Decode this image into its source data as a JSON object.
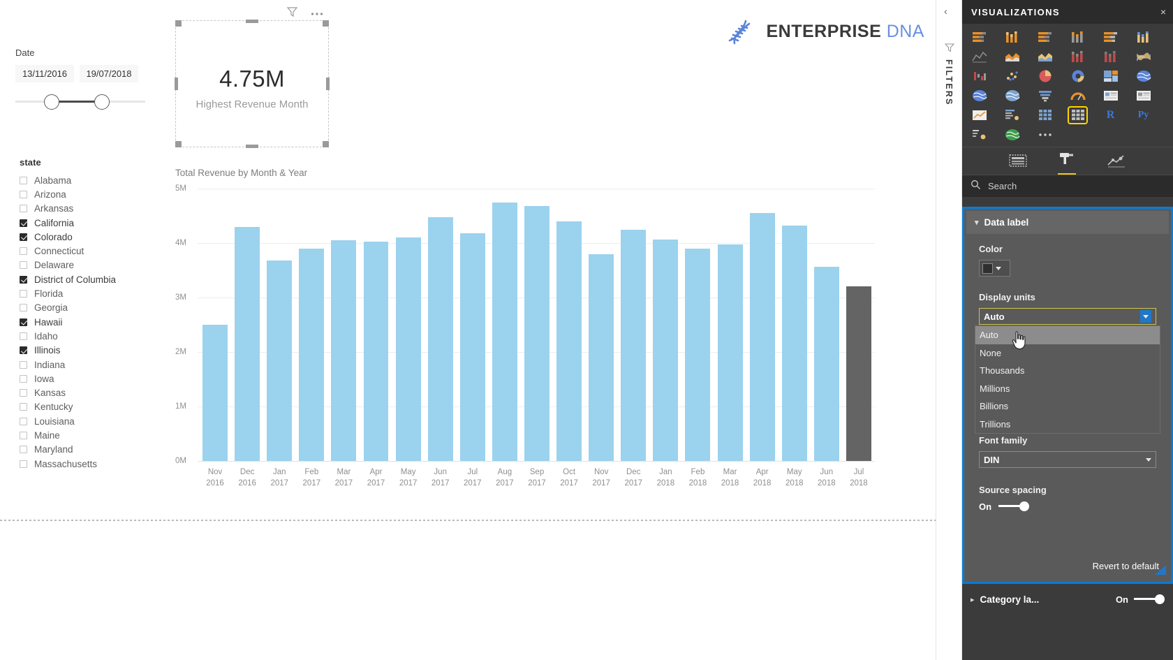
{
  "report": {
    "date_slicer": {
      "title": "Date",
      "start": "13/11/2016",
      "end": "19/07/2018"
    },
    "state_slicer": {
      "title": "state",
      "items": [
        {
          "label": "Alabama",
          "checked": false
        },
        {
          "label": "Arizona",
          "checked": false
        },
        {
          "label": "Arkansas",
          "checked": false
        },
        {
          "label": "California",
          "checked": true
        },
        {
          "label": "Colorado",
          "checked": true
        },
        {
          "label": "Connecticut",
          "checked": false
        },
        {
          "label": "Delaware",
          "checked": false
        },
        {
          "label": "District of Columbia",
          "checked": true
        },
        {
          "label": "Florida",
          "checked": false
        },
        {
          "label": "Georgia",
          "checked": false
        },
        {
          "label": "Hawaii",
          "checked": true
        },
        {
          "label": "Idaho",
          "checked": false
        },
        {
          "label": "Illinois",
          "checked": true
        },
        {
          "label": "Indiana",
          "checked": false
        },
        {
          "label": "Iowa",
          "checked": false
        },
        {
          "label": "Kansas",
          "checked": false
        },
        {
          "label": "Kentucky",
          "checked": false
        },
        {
          "label": "Louisiana",
          "checked": false
        },
        {
          "label": "Maine",
          "checked": false
        },
        {
          "label": "Maryland",
          "checked": false
        },
        {
          "label": "Massachusetts",
          "checked": false
        }
      ]
    },
    "card": {
      "value": "4.75M",
      "label": "Highest Revenue Month"
    },
    "logo": {
      "word1": "ENTERPRISE",
      "word2": "DNA"
    }
  },
  "chart_data": {
    "type": "bar",
    "title": "Total Revenue by Month & Year",
    "xlabel": "",
    "ylabel": "",
    "ylim": [
      0,
      5000000
    ],
    "grid": true,
    "legend": null,
    "tick_labels_y": [
      "0M",
      "1M",
      "2M",
      "3M",
      "4M",
      "5M"
    ],
    "bar_color": "#9bd2ee",
    "highlight_color": "#646464",
    "highlight_index": 20,
    "categories": [
      "Nov 2016",
      "Dec 2016",
      "Jan 2017",
      "Feb 2017",
      "Mar 2017",
      "Apr 2017",
      "May 2017",
      "Jun 2017",
      "Jul 2017",
      "Aug 2017",
      "Sep 2017",
      "Oct 2017",
      "Nov 2017",
      "Dec 2017",
      "Jan 2018",
      "Feb 2018",
      "Mar 2018",
      "Apr 2018",
      "May 2018",
      "Jun 2018",
      "Jul 2018"
    ],
    "categories_month": [
      "Nov",
      "Dec",
      "Jan",
      "Feb",
      "Mar",
      "Apr",
      "May",
      "Jun",
      "Jul",
      "Aug",
      "Sep",
      "Oct",
      "Nov",
      "Dec",
      "Jan",
      "Feb",
      "Mar",
      "Apr",
      "May",
      "Jun",
      "Jul"
    ],
    "categories_year": [
      "2016",
      "2016",
      "2017",
      "2017",
      "2017",
      "2017",
      "2017",
      "2017",
      "2017",
      "2017",
      "2017",
      "2017",
      "2017",
      "2017",
      "2018",
      "2018",
      "2018",
      "2018",
      "2018",
      "2018",
      "2018"
    ],
    "values": [
      2500000,
      4290000,
      3680000,
      3900000,
      4050000,
      4030000,
      4100000,
      4470000,
      4180000,
      4750000,
      4680000,
      4400000,
      3790000,
      4250000,
      4060000,
      3900000,
      3980000,
      4550000,
      4320000,
      3570000,
      3200000
    ]
  },
  "rail": {
    "collapse_icon": "chevron-left-icon",
    "filters_label": "FILTERS"
  },
  "viz_pane": {
    "title": "VISUALIZATIONS",
    "close_label": "×",
    "icons": [
      "stacked-bar-chart-icon",
      "stacked-column-chart-icon",
      "clustered-bar-chart-icon",
      "clustered-column-chart-icon",
      "pct-stacked-bar-chart-icon",
      "pct-stacked-column-chart-icon",
      "line-chart-icon",
      "area-chart-icon",
      "stacked-area-chart-icon",
      "line-stacked-column-icon",
      "line-clustered-column-icon",
      "ribbon-chart-icon",
      "waterfall-chart-icon",
      "scatter-chart-icon",
      "pie-chart-icon",
      "donut-chart-icon",
      "treemap-icon",
      "map-icon",
      "filled-map-icon",
      "shape-map-icon",
      "funnel-chart-icon",
      "gauge-chart-icon",
      "card-icon",
      "multi-row-card-icon",
      "kpi-icon",
      "slicer-icon",
      "table-icon",
      "matrix-icon",
      "r-script-visual-icon",
      "python-visual-icon",
      "key-influencers-icon",
      "arcgis-map-icon",
      "more-options-icon"
    ],
    "selected_icon_index": 27,
    "tabs": [
      {
        "name": "fields-tab",
        "active": false
      },
      {
        "name": "format-tab",
        "active": true
      },
      {
        "name": "analytics-tab",
        "active": false
      }
    ],
    "search": {
      "placeholder": "Search",
      "icon": "search-icon"
    },
    "format": {
      "section_title": "Data label",
      "section_expanded": true,
      "color_label": "Color",
      "color_value": "#2f2f2f",
      "display_units_label": "Display units",
      "display_units_value": "Auto",
      "display_units_options": [
        "Auto",
        "None",
        "Thousands",
        "Millions",
        "Billions",
        "Trillions"
      ],
      "display_units_hovered": "Auto",
      "font_family_label": "Font family",
      "font_family_value": "DIN",
      "source_spacing_label": "Source spacing",
      "source_spacing_state": "On",
      "revert_label": "Revert to default"
    },
    "next_section": {
      "label": "Category la...",
      "toggle_state": "On"
    }
  }
}
